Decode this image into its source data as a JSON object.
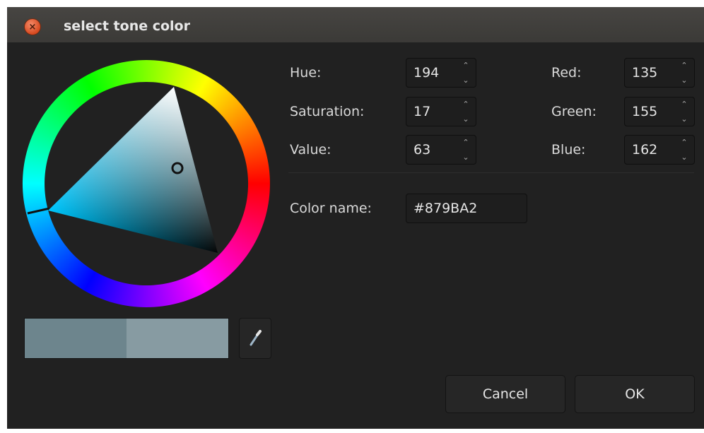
{
  "dialog": {
    "title": "select tone color",
    "close_icon": "close-icon"
  },
  "hsv": {
    "hue": {
      "label": "Hue:",
      "value": "194"
    },
    "saturation": {
      "label": "Saturation:",
      "value": "17"
    },
    "value": {
      "label": "Value:",
      "value": "63"
    }
  },
  "rgb": {
    "red": {
      "label": "Red:",
      "value": "135"
    },
    "green": {
      "label": "Green:",
      "value": "155"
    },
    "blue": {
      "label": "Blue:",
      "value": "162"
    }
  },
  "color_name": {
    "label": "Color name:",
    "value": "#879BA2"
  },
  "swatch": {
    "previous_color": "#6d858d",
    "current_color": "#879ba2"
  },
  "eyedropper_icon": "eyedropper-icon",
  "spin_icons": {
    "up": "⌃",
    "down": "⌄"
  },
  "buttons": {
    "cancel": "Cancel",
    "ok": "OK"
  }
}
